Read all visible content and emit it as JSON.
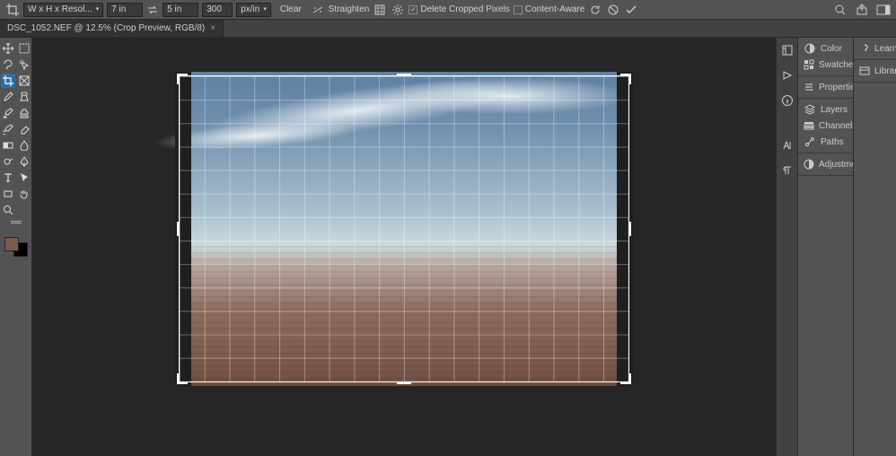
{
  "optionsBar": {
    "ratioPreset": "W x H x Resol...",
    "width": "7 in",
    "height": "5 in",
    "resolution": "300",
    "resUnit": "px/in",
    "clear": "Clear",
    "straighten": "Straighten",
    "deleteCropped": "Delete Cropped Pixels",
    "contentAware": "Content-Aware"
  },
  "document": {
    "tab": "DSC_1052.NEF @ 12.5% (Crop Preview, RGB/8)"
  },
  "panels": {
    "color": "Color",
    "swatches": "Swatches",
    "properties": "Properties",
    "layers": "Layers",
    "channels": "Channels",
    "paths": "Paths",
    "adjustments": "Adjustments",
    "learn": "Learn",
    "libraries": "Libraries"
  }
}
